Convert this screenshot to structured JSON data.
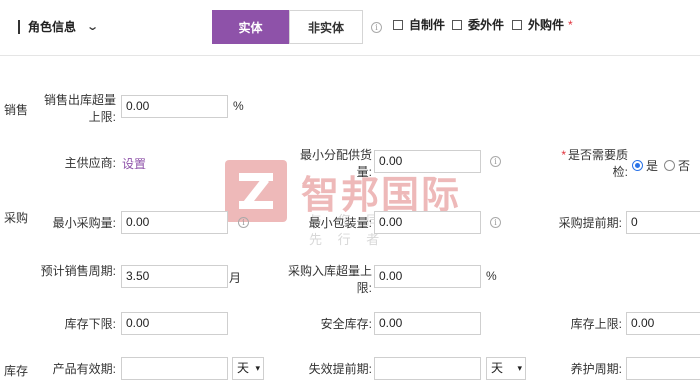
{
  "header": {
    "title": "角色信息",
    "tabs": [
      "实体",
      "非实体"
    ],
    "checks": [
      "自制件",
      "委外件",
      "外购件"
    ],
    "required_mark": "*"
  },
  "sections": {
    "sales": "销售",
    "purchase": "采购",
    "stock": "库存"
  },
  "fields": {
    "sales_over_limit": {
      "label": "销售出库超量上限:",
      "value": "0.00",
      "unit": "%"
    },
    "main_supplier": {
      "label": "主供应商:",
      "link": "设置"
    },
    "min_alloc": {
      "label": "最小分配供货量:",
      "value": "0.00"
    },
    "need_qc": {
      "label": "是否需要质检:",
      "yes": "是",
      "no": "否",
      "selected": "是"
    },
    "min_purchase": {
      "label": "最小采购量:",
      "value": "0.00"
    },
    "min_pack": {
      "label": "最小包装量:",
      "value": "0.00"
    },
    "lead_time": {
      "label": "采购提前期:",
      "value": "0"
    },
    "sales_cycle": {
      "label": "预计销售周期:",
      "value": "3.50",
      "unit": "月"
    },
    "purchase_over_limit": {
      "label": "采购入库超量上限:",
      "value": "0.00",
      "unit": "%"
    },
    "stock_lower": {
      "label": "库存下限:",
      "value": "0.00"
    },
    "safety_stock": {
      "label": "安全库存:",
      "value": "0.00"
    },
    "stock_upper": {
      "label": "库存上限:",
      "value": "0.00"
    },
    "validity": {
      "label": "产品有效期:",
      "value": "",
      "unit": "天"
    },
    "expire_advance": {
      "label": "失效提前期:",
      "value": "",
      "unit": "天"
    },
    "maintenance": {
      "label": "养护周期:",
      "value": ""
    }
  },
  "watermark": {
    "brand": "智邦国际",
    "slogan": "与 您 同 行 · 化 先 行 者"
  },
  "colors": {
    "accent": "#8e52a9",
    "required": "#e0313b",
    "radio": "#2a73e8"
  }
}
